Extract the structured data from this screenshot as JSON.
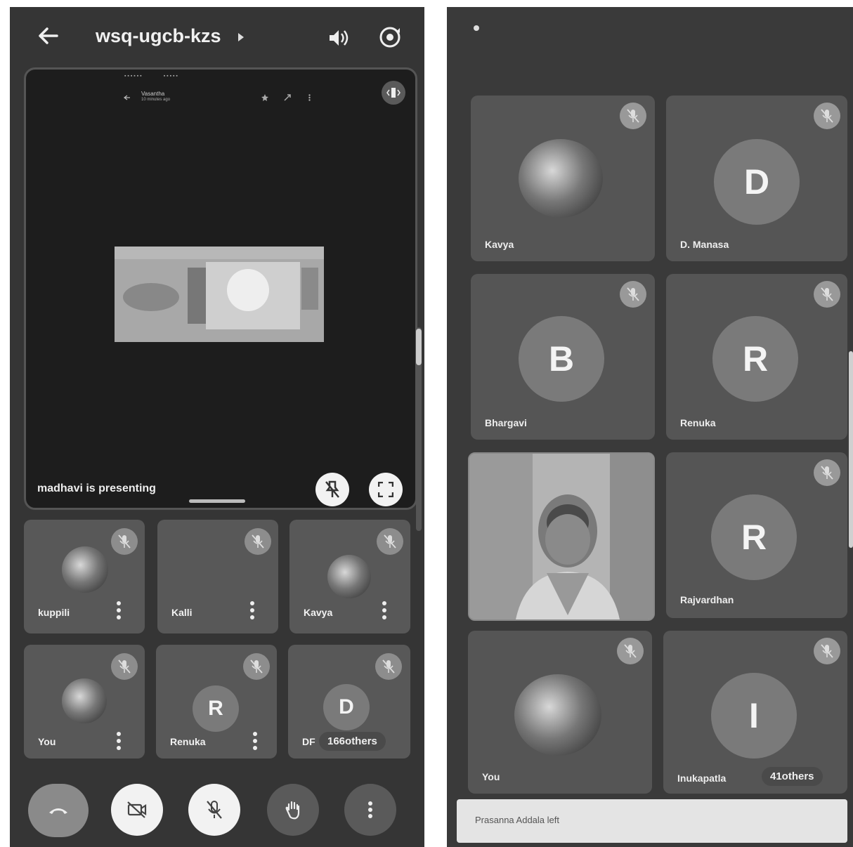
{
  "left": {
    "meeting_code": "wsq-ugcb-kzs",
    "presentation": {
      "mini_title": "Vasantha",
      "mini_subtitle": "10 minutes ago",
      "presenting_label": "madhavi is presenting"
    },
    "tiles": [
      {
        "name": "kuppili"
      },
      {
        "name": "Kalli"
      },
      {
        "name": "Kavya"
      },
      {
        "name": "You"
      },
      {
        "name": "Renuka",
        "initial": "R"
      },
      {
        "name": "DF",
        "initial": "D",
        "others": "166others"
      }
    ]
  },
  "right": {
    "tiles": [
      {
        "name": "Kavya"
      },
      {
        "name": "D. Manasa",
        "initial": "D"
      },
      {
        "name": "Bhargavi",
        "initial": "B"
      },
      {
        "name": "Renuka",
        "initial": "R"
      },
      {
        "name": "Rajvardhan",
        "initial": "R"
      },
      {
        "name": "You"
      },
      {
        "name": "Inukapatla",
        "initial": "I",
        "others": "41others"
      }
    ],
    "toast": "Prasanna Addala left"
  },
  "colors": {
    "panel_bg": "#353535",
    "tile_bg": "#585858",
    "hangup_button": "#8a8a8a",
    "active_button": "#f2f2f2"
  }
}
